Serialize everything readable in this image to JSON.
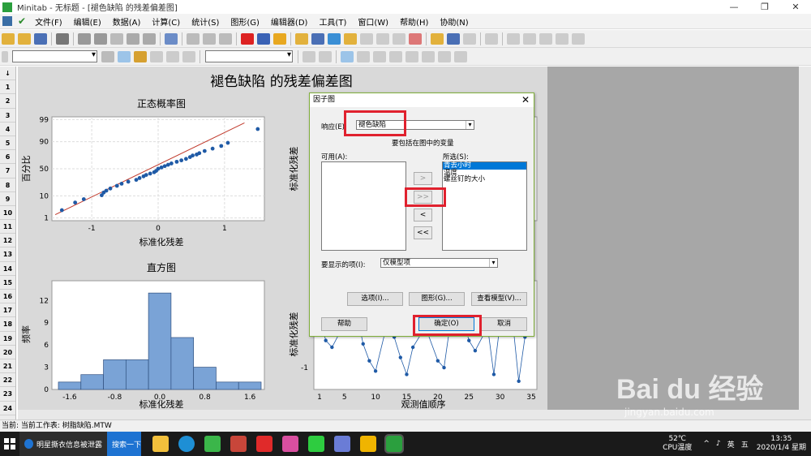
{
  "window": {
    "app_name": "Minitab",
    "title": "Minitab - 无标题 - [褪色缺陷 的残差偏差图]",
    "min": "—",
    "restore": "❐",
    "close": "✕"
  },
  "menu": [
    "文件(F)",
    "编辑(E)",
    "数据(A)",
    "计算(C)",
    "统计(S)",
    "图形(G)",
    "编辑器(D)",
    "工具(T)",
    "窗口(W)",
    "帮助(H)",
    "协助(N)"
  ],
  "row_numbers": [
    "1",
    "2",
    "3",
    "4",
    "5",
    "6",
    "7",
    "8",
    "9",
    "10",
    "11",
    "12",
    "13",
    "14",
    "15",
    "16",
    "17",
    "18",
    "19",
    "20",
    "21",
    "22",
    "23",
    "24",
    "25"
  ],
  "row_header_arrow": "↓",
  "graph": {
    "main_title": "褪色缺陷 的残差偏差图",
    "normal_plot": {
      "title": "正态概率图",
      "xlabel": "标准化残差",
      "ylabel": "百分比",
      "xticks": [
        "-1",
        "0",
        "1"
      ],
      "yticks": [
        "99",
        "90",
        "50",
        "10",
        "1"
      ]
    },
    "histogram": {
      "title": "直方图",
      "xlabel": "标准化残差",
      "ylabel": "频率",
      "xticks": [
        "-1.6",
        "-0.8",
        "0.0",
        "0.8",
        "1.6"
      ],
      "yticks": [
        "12",
        "9",
        "6",
        "3",
        "0"
      ]
    },
    "right_top": {
      "ylabel": "标准化残差"
    },
    "right_bottom": {
      "ylabel": "标准化残差",
      "xlabel": "观测值顺序",
      "xticks": [
        "1",
        "5",
        "10",
        "15",
        "20",
        "25",
        "30",
        "35"
      ],
      "ytick": "-1"
    }
  },
  "chart_data": [
    {
      "type": "scatter",
      "title": "正态概率图",
      "xlabel": "标准化残差",
      "ylabel": "百分比",
      "xlim": [
        -1.6,
        1.6
      ],
      "ylim": [
        1,
        99
      ],
      "x": [
        -1.45,
        -1.25,
        -1.12,
        -0.85,
        -0.82,
        -0.78,
        -0.72,
        -0.62,
        -0.55,
        -0.45,
        -0.33,
        -0.28,
        -0.22,
        -0.18,
        -0.12,
        -0.06,
        -0.03,
        0.0,
        0.05,
        0.1,
        0.15,
        0.2,
        0.28,
        0.35,
        0.42,
        0.48,
        0.52,
        0.58,
        0.62,
        0.7,
        0.82,
        0.95,
        1.05,
        1.5
      ],
      "y": [
        2.5,
        5.5,
        7.5,
        10.5,
        13,
        15,
        17.5,
        21,
        24,
        27,
        30,
        33,
        36,
        38.5,
        41,
        43.5,
        46,
        50,
        52.5,
        55,
        57.5,
        60,
        63,
        65.5,
        68,
        71,
        73.5,
        75,
        77,
        80,
        83,
        86,
        89,
        97
      ]
    },
    {
      "type": "bar",
      "title": "直方图",
      "xlabel": "标准化残差",
      "ylabel": "频率",
      "ylim": [
        0,
        14
      ],
      "bins": [
        -1.8,
        -1.4,
        -1.0,
        -0.6,
        -0.2,
        0.2,
        0.6,
        1.0,
        1.4,
        1.8
      ],
      "values": [
        1,
        2,
        4,
        4,
        13,
        7,
        3,
        1,
        1
      ]
    },
    {
      "type": "line",
      "title": "",
      "xlabel": "观测值顺序",
      "ylabel": "标准化残差",
      "x": [
        1,
        2,
        3,
        5,
        7,
        8,
        9,
        10,
        12,
        13,
        14,
        15,
        16,
        18,
        20,
        21,
        22,
        24,
        25,
        26,
        28,
        29,
        30,
        32,
        33,
        34,
        35
      ],
      "y": [
        0.4,
        -0.3,
        -0.5,
        0.2,
        0.5,
        -0.4,
        -0.9,
        -1.2,
        0.3,
        -0.2,
        -0.8,
        -1.3,
        -0.5,
        0.1,
        -0.9,
        -1.1,
        0.2,
        0.4,
        -0.3,
        -0.6,
        0.1,
        -1.3,
        0.2,
        0.3,
        -1.5,
        -0.2,
        0.4
      ]
    }
  ],
  "dialog": {
    "title": "因子图",
    "close": "✕",
    "response_label": "响应(E):",
    "response_value": "褪色缺陷",
    "include_label": "要包括在图中的变量",
    "available_label": "可用(A):",
    "selected_label": "所选(S):",
    "selected_items": [
      "青去小时",
      "温度",
      "螺丝钉的大小"
    ],
    "move_right": ">",
    "move_all_right": ">>",
    "move_left": "<",
    "move_all_left": "<<",
    "display_label": "要显示的项(I):",
    "display_value": "仅模型项",
    "options_btn": "选项(I)...",
    "graphs_btn": "图形(G)...",
    "view_model_btn": "查看模型(V)...",
    "help_btn": "帮助",
    "ok_btn": "确定(O)",
    "cancel_btn": "取消"
  },
  "status": {
    "text": "当前: 当前工作表: 树脂缺陷.MTW"
  },
  "taskbar": {
    "task1": "明星撕衣信息被泄露",
    "task2": "搜索一下",
    "temp": "52℃",
    "temp_label": "CPU温度",
    "lang": "英",
    "ime": "五",
    "time": "13:35",
    "date": "2020/1/4 星期"
  },
  "watermark": {
    "main": "Bai du 经验",
    "sub": "jingyan.baidu.com"
  }
}
